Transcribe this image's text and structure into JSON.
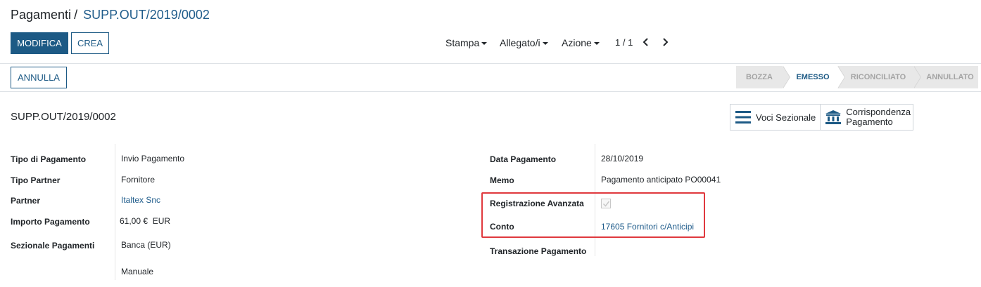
{
  "breadcrumb": {
    "parent": "Pagamenti",
    "separator": "/",
    "current": "SUPP.OUT/2019/0002"
  },
  "buttons": {
    "edit": "MODIFICA",
    "create": "CREA",
    "cancel": "ANNULLA"
  },
  "toolbar": {
    "print": "Stampa",
    "attachments": "Allegato/i",
    "action": "Azione"
  },
  "pager": {
    "value": "1 / 1"
  },
  "statusbar": {
    "steps": [
      {
        "label": "BOZZA",
        "active": false
      },
      {
        "label": "EMESSO",
        "active": true
      },
      {
        "label": "RICONCILIATO",
        "active": false
      },
      {
        "label": "ANNULLATO",
        "active": false
      }
    ]
  },
  "record": {
    "title": "SUPP.OUT/2019/0002"
  },
  "smart_buttons": {
    "journal_items": "Voci Sezionale",
    "payment_matching_line1": "Corrispondenza",
    "payment_matching_line2": "Pagamento"
  },
  "fields_left": [
    {
      "label": "Tipo di Pagamento",
      "value": "Invio Pagamento"
    },
    {
      "label": "Tipo Partner",
      "value": "Fornitore"
    },
    {
      "label": "Partner",
      "value": "Italtex Snc"
    },
    {
      "label": "Importo Pagamento",
      "value": "61,00 €  EUR"
    },
    {
      "label": "Sezionale Pagamenti",
      "value": "Banca (EUR)"
    },
    {
      "label": "",
      "value": "Manuale"
    }
  ],
  "fields_right": [
    {
      "label": "Data Pagamento",
      "value": "28/10/2019"
    },
    {
      "label": "Memo",
      "value": "Pagamento anticipato PO00041"
    },
    {
      "label": "Registrazione Avanzata",
      "value": "",
      "checked": true
    },
    {
      "label": "Conto",
      "value": "17605 Fornitori c/Anticipi"
    },
    {
      "label": "Transazione Pagamento",
      "value": ""
    }
  ],
  "colors": {
    "primary": "#1d5a85",
    "link": "#1f5c8b",
    "highlight": "#e0393e",
    "status_inactive_bg": "#e8e8e8"
  }
}
